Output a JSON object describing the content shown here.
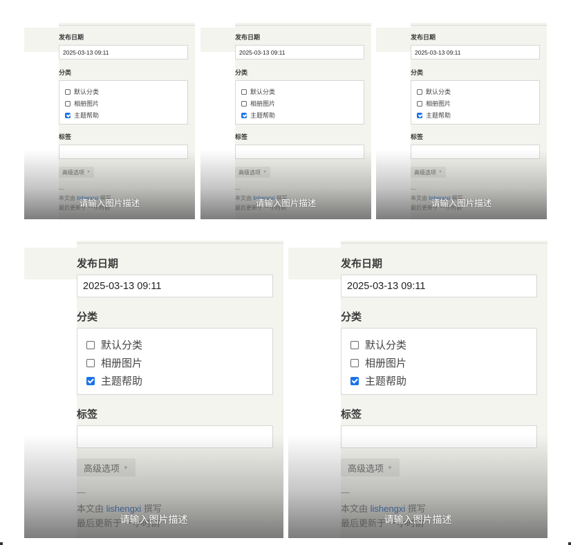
{
  "panel": {
    "publish_date_label": "发布日期",
    "publish_date_value": "2025-03-13 09:11",
    "category_label": "分类",
    "categories": [
      {
        "label": "默认分类",
        "checked": false
      },
      {
        "label": "相册图片",
        "checked": false
      },
      {
        "label": "主题帮助",
        "checked": true
      }
    ],
    "tags_label": "标签",
    "tags_value": "",
    "advanced_options_label": "高级选项",
    "advanced_caret": "▼",
    "divider": "—",
    "meta_prefix": "本文由",
    "meta_author": "lishengxi",
    "meta_suffix": "撰写",
    "meta_updated": "最后更新于 一小时前"
  },
  "caption": "请输入图片描述",
  "colors": {
    "panel_bg": "#f4f4ef",
    "checkbox_checked": "#1a73e8",
    "author_link": "#2a6fc9",
    "caption_text": "#ffffff"
  },
  "icons": {
    "checkbox_checked": "checkbox-checked-icon",
    "checkbox_unchecked": "checkbox-unchecked-icon",
    "dropdown": "caret-down-icon"
  }
}
